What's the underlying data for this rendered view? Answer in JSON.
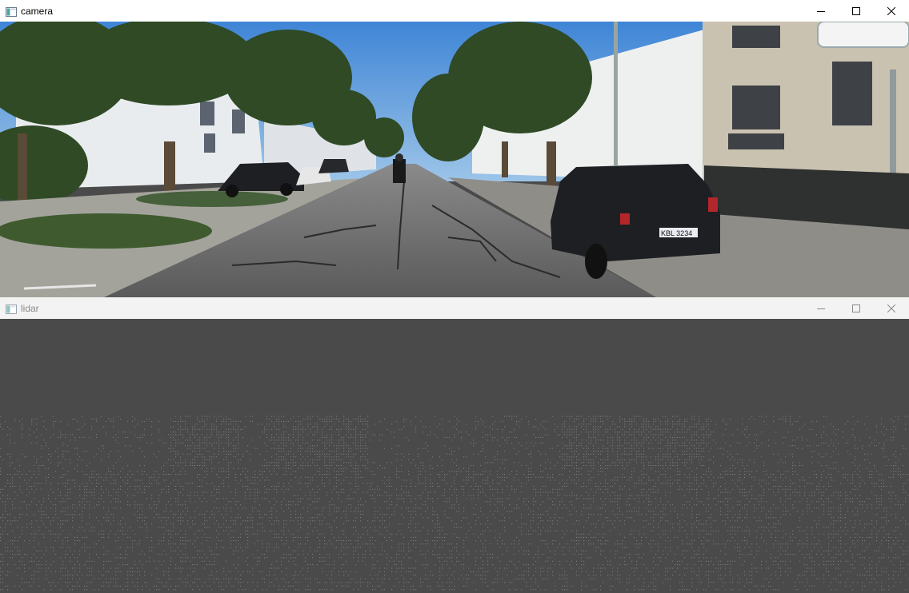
{
  "windows": {
    "camera": {
      "title": "camera",
      "state": "active",
      "icons": [
        "app-window-icon",
        "minimize-icon",
        "maximize-icon",
        "close-icon"
      ]
    },
    "lidar": {
      "title": "lidar",
      "state": "inactive",
      "icons": [
        "app-window-icon",
        "minimize-icon",
        "maximize-icon",
        "close-icon"
      ]
    }
  },
  "camera_view": {
    "license_plate": "KBL 3234",
    "sky_color": "#5e9ad8",
    "road_color": "#5f5f5f"
  },
  "lidar_view": {
    "background_color": "#4a4a4a",
    "point_color": "#bdbdbd"
  }
}
